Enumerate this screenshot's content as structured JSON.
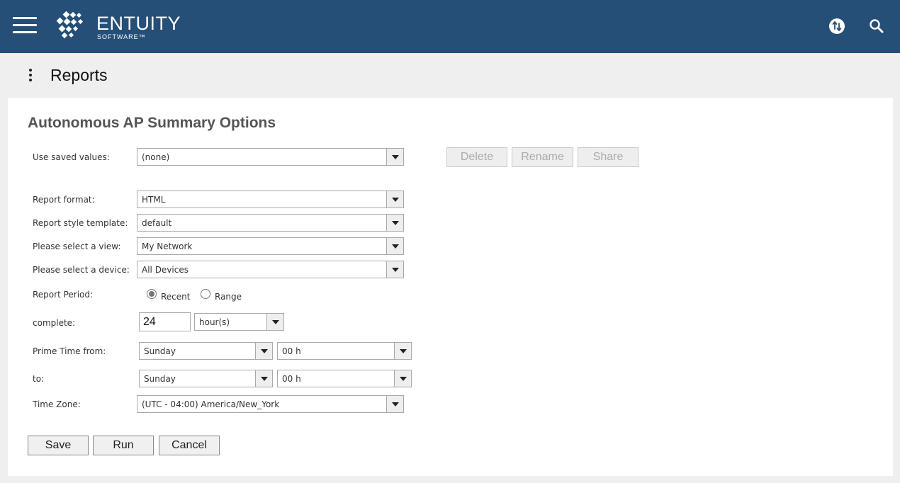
{
  "app": {
    "name": "ENTUITY",
    "sub": "SOFTWARE™"
  },
  "header": {
    "menu_icon": "hamburger-icon",
    "sync_icon": "sync-icon",
    "search_icon": "search-icon"
  },
  "page": {
    "title": "Reports",
    "menu_icon": "kebab-icon"
  },
  "form": {
    "title": "Autonomous AP Summary Options",
    "saved": {
      "label": "Use saved values:",
      "value": "(none)"
    },
    "actions": {
      "delete": "Delete",
      "rename": "Rename",
      "share": "Share"
    },
    "format": {
      "label": "Report format:",
      "value": "HTML"
    },
    "template": {
      "label": "Report style template:",
      "value": "default"
    },
    "view": {
      "label": "Please select a view:",
      "value": "My Network"
    },
    "device": {
      "label": "Please select a device:",
      "value": "All Devices"
    },
    "period": {
      "label": "Report Period:",
      "recent": "Recent",
      "range": "Range",
      "selected": "Recent"
    },
    "complete": {
      "label": "complete:",
      "value": "24",
      "unit": "hour(s)"
    },
    "prime_from": {
      "label": "Prime Time from:",
      "day": "Sunday",
      "hour": "00 h"
    },
    "prime_to": {
      "label": "to:",
      "day": "Sunday",
      "hour": "00 h"
    },
    "timezone": {
      "label": "Time Zone:",
      "value": "(UTC - 04:00) America/New_York"
    },
    "buttons": {
      "save": "Save",
      "run": "Run",
      "cancel": "Cancel"
    }
  },
  "colors": {
    "header_bg": "#254f77",
    "page_bg": "#efefef",
    "panel_bg": "#ffffff"
  }
}
